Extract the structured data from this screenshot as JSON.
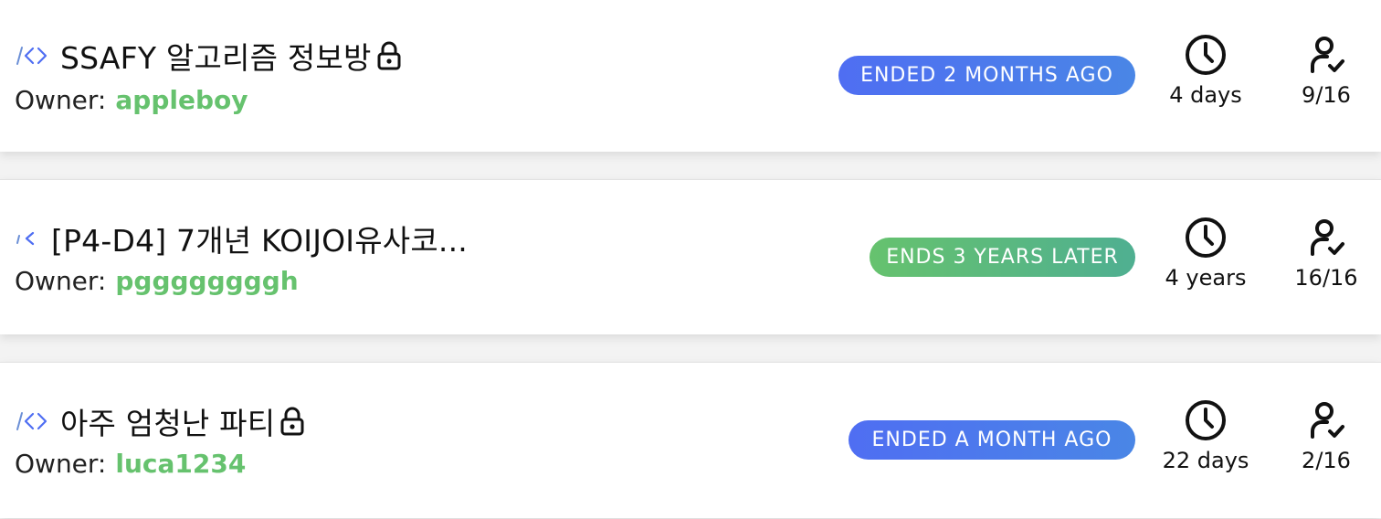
{
  "rooms": [
    {
      "title": "SSAFY 알고리즘 정보방",
      "owner_label": "Owner:",
      "owner": "appleboy",
      "status": "ENDED 2 MONTHS AGO",
      "duration": "4 days",
      "participants": "9/16",
      "locked": true,
      "status_color": "#4f6ef2"
    },
    {
      "title": "[P4-D4] 7개년 KOIJOI유사코...",
      "owner_label": "Owner:",
      "owner": "pggggggggh",
      "status": "ENDS 3 YEARS LATER",
      "duration": "4 years",
      "participants": "16/16",
      "locked": false,
      "status_color": "#66c26e"
    },
    {
      "title": "아주 엄청난 파티",
      "owner_label": "Owner:",
      "owner": "luca1234",
      "status": "ENDED A MONTH AGO",
      "duration": "22 days",
      "participants": "2/16",
      "locked": true,
      "status_color": "#4f6ef2"
    }
  ],
  "icons": {
    "room": "code-icon",
    "lock": "lock-icon",
    "duration": "clock-icon",
    "participants": "user-check-icon"
  },
  "colors": {
    "owner_name": "#66c26e",
    "badge_blue": "#4f6ef2",
    "badge_green": "#66c26e"
  }
}
